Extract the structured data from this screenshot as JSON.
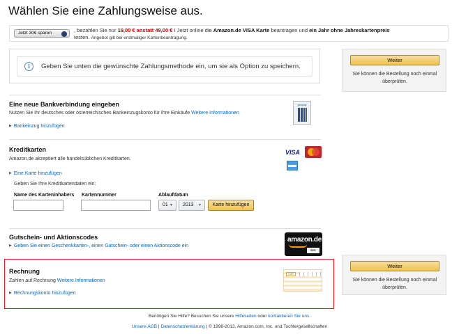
{
  "page": {
    "title": "Wählen Sie eine Zahlungsweise aus."
  },
  "promo": {
    "button_label": "Jetzt 30€ sparen",
    "text_pre": ", bezahlen Sie nur",
    "price_text": "19,00 € anstatt 49,00 €",
    "text_mid": "! Jetzt online die",
    "card_name": "Amazon.de VISA Karte",
    "text_mid2": "beantragen und",
    "offer": "ein Jahr ohne Jahreskartenpreis",
    "text_line2": "testen.",
    "small_note": "Angebot gilt bei erstmaliger Kartenbeantragung."
  },
  "info": {
    "icon_name": "info-icon",
    "text": "Geben Sie unten die gewünschte Zahlungsmethode ein, um sie als Option zu speichern."
  },
  "sidebar": {
    "continue_label": "Weiter",
    "review_text": "Sie können die Bestellung noch einmal überprüfen."
  },
  "bank": {
    "title": "Eine neue Bankverbindung eingeben",
    "description": "Nutzen Sie Ihr deutsches oder österreichisches Bankeinzugskonto für Ihre Einkäufe",
    "more_info_link": "Weitere Informationen",
    "add_link": "Bankeinzug hinzufügen",
    "logo_text": "giropay"
  },
  "credit_cards": {
    "title": "Kreditkarten",
    "description": "Amazon.de akzeptiert alle handelsüblichen Kreditkarten.",
    "add_link": "Eine Karte hinzufügen",
    "note": "Geben Sie Ihre Kreditkartendaten ein:",
    "holder_label": "Name des Karteninhabers",
    "number_label": "Kartennummer",
    "expiry_label": "Ablaufdatum",
    "expiry_month": "01",
    "expiry_year": "2013",
    "add_button": "Karte hinzufügen",
    "visa_text": "VISA"
  },
  "vouchers": {
    "title": "Gutschein- und Aktionscodes",
    "link": "Geben Sie einen Geschenkkarten-, einen Gutschein- oder einen Aktionscode ein",
    "card_brand": "amazon.de",
    "card_value": "€€€"
  },
  "invoice": {
    "title": "Rechnung",
    "description": "Zahlen auf Rechnung",
    "more_info_link": "Weitere Informationen",
    "add_link": "Rechnungskonto hinzufügen",
    "doc_label": "EUR"
  },
  "footer": {
    "help_pre": "Benötigen Sie Hilfe? Besuchen Sie unsere",
    "help_link": "Hilfeseiten",
    "help_mid": "oder",
    "contact_link": "kontaktieren Sie uns",
    "agb_link": "Unsere AGB",
    "privacy_link": "Datenschutzerklärung",
    "copyright": "| © 1998-2013, Amazon.com, Inc. und Tochtergesellschaften"
  },
  "colors": {
    "link": "#0066c0",
    "button_yellow": "#f0c14b",
    "highlight_border": "#e31e24",
    "price_red": "#c40000"
  }
}
